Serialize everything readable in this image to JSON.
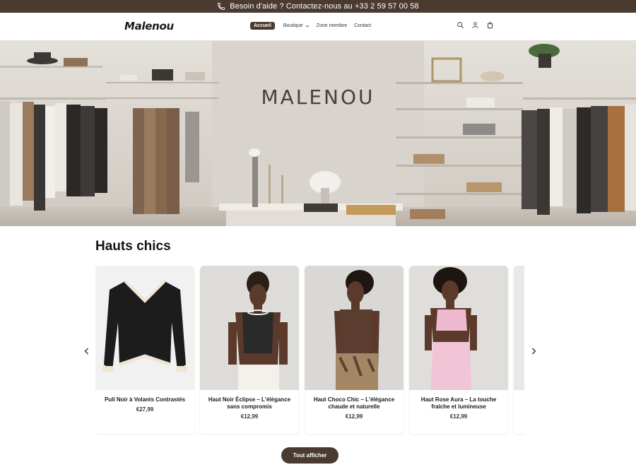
{
  "announcement": {
    "text": "Besoin d'aide ? Contactez-nous au +33 2 59 57 00 58",
    "icon": "phone-icon"
  },
  "header": {
    "logo": "Malenou",
    "nav": [
      {
        "label": "Accueil",
        "active": true
      },
      {
        "label": "Boutique",
        "has_dropdown": true
      },
      {
        "label": "Zone membre"
      },
      {
        "label": "Contact"
      }
    ],
    "icons": [
      "search-icon",
      "account-icon",
      "cart-icon"
    ]
  },
  "hero": {
    "title": "MALENOU"
  },
  "section": {
    "title": "Hauts chics",
    "products": [
      {
        "name": "Pull Noir à Volants Contrastés",
        "price": "€27,99"
      },
      {
        "name": "Haut Noir Éclipse – L'élégance sans compromis",
        "price": "€12,99"
      },
      {
        "name": "Haut Choco Chic – L'élégance chaude et naturelle",
        "price": "€12,99"
      },
      {
        "name": "Haut Rose Aura – La touche fraîche et lumineuse",
        "price": "€12,99"
      }
    ],
    "view_all": "Tout afficher"
  },
  "colors": {
    "brand": "#4a3a2f",
    "background": "#ffffff"
  }
}
